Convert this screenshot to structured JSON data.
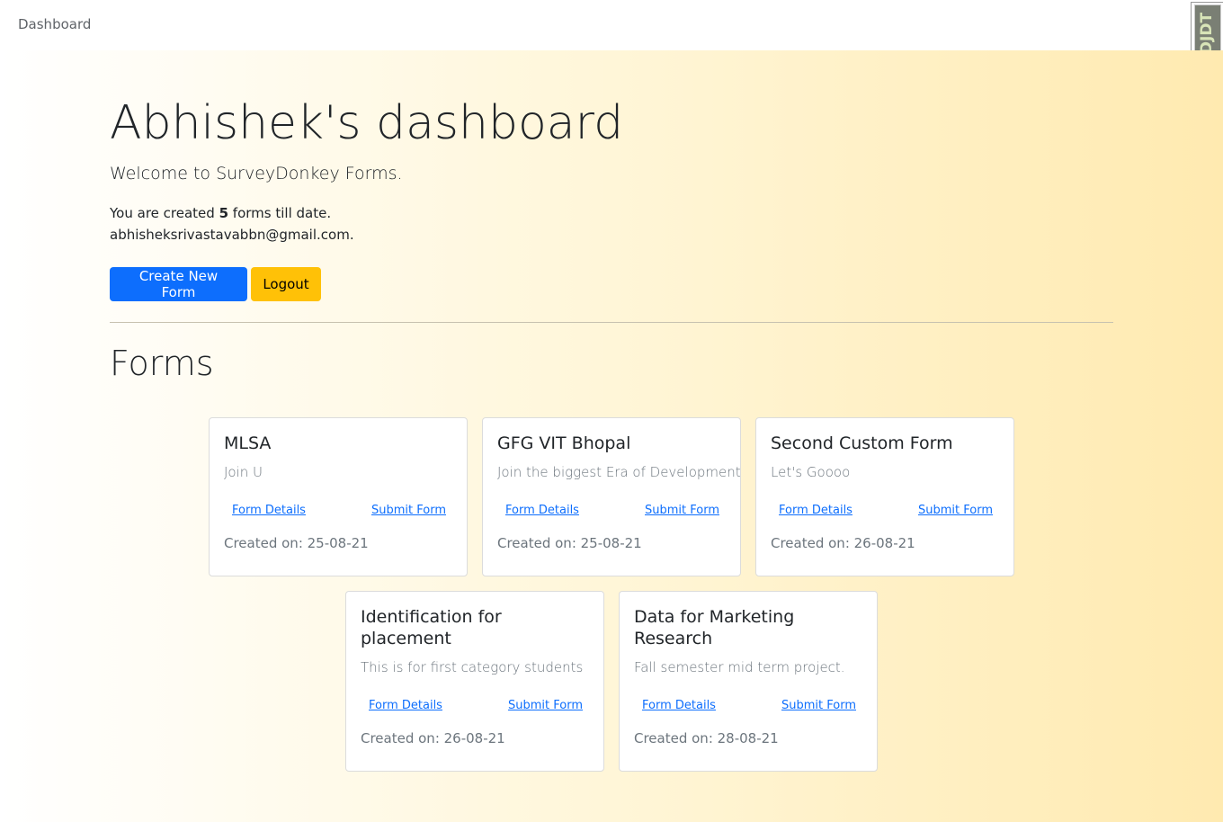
{
  "navbar": {
    "brand": "Dashboard",
    "debug_toolbar": "DJDT"
  },
  "header": {
    "title": "Abhishek's dashboard",
    "lead": "Welcome to SurveyDonkey Forms.",
    "count_prefix": "You are created",
    "count": "5",
    "count_suffix": "forms till date.",
    "email": "abhisheksrivastavabbn@gmail.com."
  },
  "actions": {
    "create_label": "Create New Form",
    "logout_label": "Logout"
  },
  "forms_section": {
    "heading": "Forms"
  },
  "forms": [
    {
      "title": "MLSA",
      "description": "Join U",
      "details_label": "Form Details",
      "submit_label": "Submit Form",
      "created": "Created on: 25-08-21"
    },
    {
      "title": "GFG VIT Bhopal",
      "description": "Join the biggest Era of Development",
      "details_label": "Form Details",
      "submit_label": "Submit Form",
      "created": "Created on: 25-08-21"
    },
    {
      "title": "Second Custom Form",
      "description": "Let's Goooo",
      "details_label": "Form Details",
      "submit_label": "Submit Form",
      "created": "Created on: 26-08-21"
    },
    {
      "title": "Identification for placement",
      "description": "This is for first category students",
      "details_label": "Form Details",
      "submit_label": "Submit Form",
      "created": "Created on: 26-08-21"
    },
    {
      "title": "Data for Marketing Research",
      "description": "Fall semester mid term project.",
      "details_label": "Form Details",
      "submit_label": "Submit Form",
      "created": "Created on: 28-08-21"
    }
  ],
  "colors": {
    "primary": "#0d6efd",
    "warning": "#ffc107",
    "gradient_end": "#ffeab0"
  }
}
